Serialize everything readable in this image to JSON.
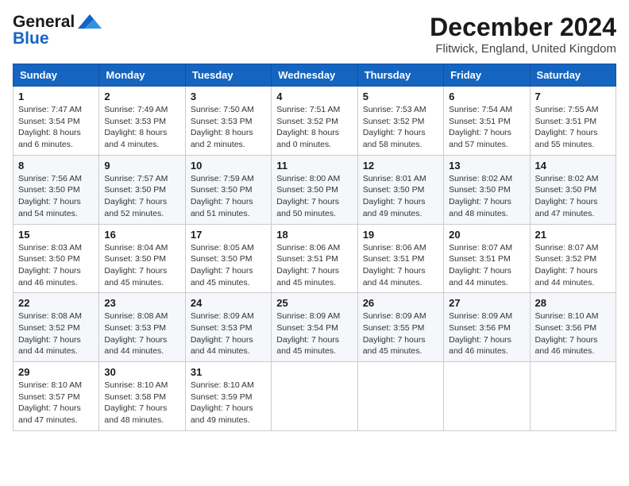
{
  "header": {
    "logo_line1": "General",
    "logo_line2": "Blue",
    "month": "December 2024",
    "location": "Flitwick, England, United Kingdom"
  },
  "weekdays": [
    "Sunday",
    "Monday",
    "Tuesday",
    "Wednesday",
    "Thursday",
    "Friday",
    "Saturday"
  ],
  "weeks": [
    [
      {
        "day": "1",
        "sunrise": "Sunrise: 7:47 AM",
        "sunset": "Sunset: 3:54 PM",
        "daylight": "Daylight: 8 hours and 6 minutes."
      },
      {
        "day": "2",
        "sunrise": "Sunrise: 7:49 AM",
        "sunset": "Sunset: 3:53 PM",
        "daylight": "Daylight: 8 hours and 4 minutes."
      },
      {
        "day": "3",
        "sunrise": "Sunrise: 7:50 AM",
        "sunset": "Sunset: 3:53 PM",
        "daylight": "Daylight: 8 hours and 2 minutes."
      },
      {
        "day": "4",
        "sunrise": "Sunrise: 7:51 AM",
        "sunset": "Sunset: 3:52 PM",
        "daylight": "Daylight: 8 hours and 0 minutes."
      },
      {
        "day": "5",
        "sunrise": "Sunrise: 7:53 AM",
        "sunset": "Sunset: 3:52 PM",
        "daylight": "Daylight: 7 hours and 58 minutes."
      },
      {
        "day": "6",
        "sunrise": "Sunrise: 7:54 AM",
        "sunset": "Sunset: 3:51 PM",
        "daylight": "Daylight: 7 hours and 57 minutes."
      },
      {
        "day": "7",
        "sunrise": "Sunrise: 7:55 AM",
        "sunset": "Sunset: 3:51 PM",
        "daylight": "Daylight: 7 hours and 55 minutes."
      }
    ],
    [
      {
        "day": "8",
        "sunrise": "Sunrise: 7:56 AM",
        "sunset": "Sunset: 3:50 PM",
        "daylight": "Daylight: 7 hours and 54 minutes."
      },
      {
        "day": "9",
        "sunrise": "Sunrise: 7:57 AM",
        "sunset": "Sunset: 3:50 PM",
        "daylight": "Daylight: 7 hours and 52 minutes."
      },
      {
        "day": "10",
        "sunrise": "Sunrise: 7:59 AM",
        "sunset": "Sunset: 3:50 PM",
        "daylight": "Daylight: 7 hours and 51 minutes."
      },
      {
        "day": "11",
        "sunrise": "Sunrise: 8:00 AM",
        "sunset": "Sunset: 3:50 PM",
        "daylight": "Daylight: 7 hours and 50 minutes."
      },
      {
        "day": "12",
        "sunrise": "Sunrise: 8:01 AM",
        "sunset": "Sunset: 3:50 PM",
        "daylight": "Daylight: 7 hours and 49 minutes."
      },
      {
        "day": "13",
        "sunrise": "Sunrise: 8:02 AM",
        "sunset": "Sunset: 3:50 PM",
        "daylight": "Daylight: 7 hours and 48 minutes."
      },
      {
        "day": "14",
        "sunrise": "Sunrise: 8:02 AM",
        "sunset": "Sunset: 3:50 PM",
        "daylight": "Daylight: 7 hours and 47 minutes."
      }
    ],
    [
      {
        "day": "15",
        "sunrise": "Sunrise: 8:03 AM",
        "sunset": "Sunset: 3:50 PM",
        "daylight": "Daylight: 7 hours and 46 minutes."
      },
      {
        "day": "16",
        "sunrise": "Sunrise: 8:04 AM",
        "sunset": "Sunset: 3:50 PM",
        "daylight": "Daylight: 7 hours and 45 minutes."
      },
      {
        "day": "17",
        "sunrise": "Sunrise: 8:05 AM",
        "sunset": "Sunset: 3:50 PM",
        "daylight": "Daylight: 7 hours and 45 minutes."
      },
      {
        "day": "18",
        "sunrise": "Sunrise: 8:06 AM",
        "sunset": "Sunset: 3:51 PM",
        "daylight": "Daylight: 7 hours and 45 minutes."
      },
      {
        "day": "19",
        "sunrise": "Sunrise: 8:06 AM",
        "sunset": "Sunset: 3:51 PM",
        "daylight": "Daylight: 7 hours and 44 minutes."
      },
      {
        "day": "20",
        "sunrise": "Sunrise: 8:07 AM",
        "sunset": "Sunset: 3:51 PM",
        "daylight": "Daylight: 7 hours and 44 minutes."
      },
      {
        "day": "21",
        "sunrise": "Sunrise: 8:07 AM",
        "sunset": "Sunset: 3:52 PM",
        "daylight": "Daylight: 7 hours and 44 minutes."
      }
    ],
    [
      {
        "day": "22",
        "sunrise": "Sunrise: 8:08 AM",
        "sunset": "Sunset: 3:52 PM",
        "daylight": "Daylight: 7 hours and 44 minutes."
      },
      {
        "day": "23",
        "sunrise": "Sunrise: 8:08 AM",
        "sunset": "Sunset: 3:53 PM",
        "daylight": "Daylight: 7 hours and 44 minutes."
      },
      {
        "day": "24",
        "sunrise": "Sunrise: 8:09 AM",
        "sunset": "Sunset: 3:53 PM",
        "daylight": "Daylight: 7 hours and 44 minutes."
      },
      {
        "day": "25",
        "sunrise": "Sunrise: 8:09 AM",
        "sunset": "Sunset: 3:54 PM",
        "daylight": "Daylight: 7 hours and 45 minutes."
      },
      {
        "day": "26",
        "sunrise": "Sunrise: 8:09 AM",
        "sunset": "Sunset: 3:55 PM",
        "daylight": "Daylight: 7 hours and 45 minutes."
      },
      {
        "day": "27",
        "sunrise": "Sunrise: 8:09 AM",
        "sunset": "Sunset: 3:56 PM",
        "daylight": "Daylight: 7 hours and 46 minutes."
      },
      {
        "day": "28",
        "sunrise": "Sunrise: 8:10 AM",
        "sunset": "Sunset: 3:56 PM",
        "daylight": "Daylight: 7 hours and 46 minutes."
      }
    ],
    [
      {
        "day": "29",
        "sunrise": "Sunrise: 8:10 AM",
        "sunset": "Sunset: 3:57 PM",
        "daylight": "Daylight: 7 hours and 47 minutes."
      },
      {
        "day": "30",
        "sunrise": "Sunrise: 8:10 AM",
        "sunset": "Sunset: 3:58 PM",
        "daylight": "Daylight: 7 hours and 48 minutes."
      },
      {
        "day": "31",
        "sunrise": "Sunrise: 8:10 AM",
        "sunset": "Sunset: 3:59 PM",
        "daylight": "Daylight: 7 hours and 49 minutes."
      },
      null,
      null,
      null,
      null
    ]
  ]
}
